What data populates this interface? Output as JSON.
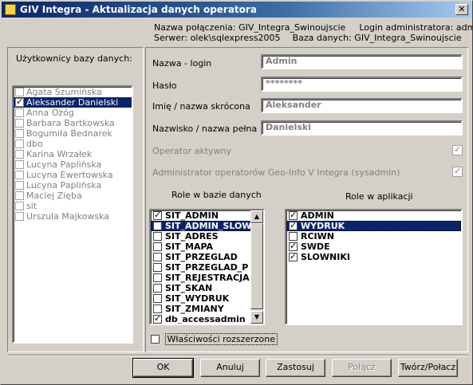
{
  "window": {
    "title": "GIV Integra - Aktualizacja danych operatora",
    "close_glyph": "✕"
  },
  "connection": {
    "name_label": "Nazwa połączenia:",
    "name_value": "GIV_Integra_Swinoujscie",
    "admin_label": "Login administratora:",
    "admin_value": "admin",
    "server_label": "Serwer:",
    "server_value": "olek\\sqlexpress2005",
    "db_label": "Baza danych:",
    "db_value": "GIV_Integra_Swinoujscie"
  },
  "users": {
    "title": "Użytkownicy bazy danych:",
    "items": [
      {
        "label": "Agata Szumińska",
        "checked": false
      },
      {
        "label": "Aleksander Danielski",
        "checked": true,
        "selected": true
      },
      {
        "label": "Anna Ożóg",
        "checked": false
      },
      {
        "label": "Barbara Bartkowska",
        "checked": false
      },
      {
        "label": "Bogumiła Bednarek",
        "checked": false
      },
      {
        "label": "dbo",
        "checked": false
      },
      {
        "label": "Karina Wrzałek",
        "checked": false
      },
      {
        "label": "Lucyna   Paplińska",
        "checked": false
      },
      {
        "label": "Lucyna Ewertowska",
        "checked": false
      },
      {
        "label": "Lucyna Paplińska",
        "checked": false
      },
      {
        "label": "Maciej Zięba",
        "checked": false
      },
      {
        "label": "sit",
        "checked": false
      },
      {
        "label": "Urszula Majkowska",
        "checked": false
      }
    ]
  },
  "form": {
    "login_label": "Nazwa - login",
    "login_value": "Admin",
    "password_label": "Hasło",
    "password_value": "********",
    "firstname_label": "Imię / nazwa skrócona",
    "firstname_value": "Aleksander",
    "lastname_label": "Nazwisko / nazwa pełna",
    "lastname_value": "Danielski",
    "active_label": "Operator aktywny",
    "sysadmin_label": "Administrator operatorów Geo-Info V Integra (sysadmin)"
  },
  "db_roles": {
    "title": "Role w bazie danych",
    "items": [
      {
        "label": "SIT_ADMIN",
        "checked": true
      },
      {
        "label": "SIT_ADMIN_SLOWNIK",
        "checked": false,
        "selected": true
      },
      {
        "label": "SIT_ADRES",
        "checked": false
      },
      {
        "label": "SIT_MAPA",
        "checked": false
      },
      {
        "label": "SIT_PRZEGLAD",
        "checked": false
      },
      {
        "label": "SIT_PRZEGLAD_P",
        "checked": false
      },
      {
        "label": "SIT_REJESTRACJA",
        "checked": false
      },
      {
        "label": "SIT_SKAN",
        "checked": false
      },
      {
        "label": "SIT_WYDRUK",
        "checked": false
      },
      {
        "label": "SIT_ZMIANY",
        "checked": false
      },
      {
        "label": "db_accessadmin",
        "checked": true
      }
    ],
    "scroll_up": "▲",
    "scroll_down": "▼"
  },
  "app_roles": {
    "title": "Role w aplikacji",
    "items": [
      {
        "label": "ADMIN",
        "checked": true
      },
      {
        "label": "WYDRUK",
        "checked": true,
        "selected": true
      },
      {
        "label": "RCIWN",
        "checked": false
      },
      {
        "label": "SWDE",
        "checked": true
      },
      {
        "label": "SLOWNIKI",
        "checked": true
      }
    ]
  },
  "extended": {
    "label": "Właściwości rozszerzone"
  },
  "buttons": {
    "ok": "OK",
    "cancel": "Anuluj",
    "apply": "Zastosuj",
    "connect": "Połącz",
    "create": "Twórz/Połacz"
  }
}
